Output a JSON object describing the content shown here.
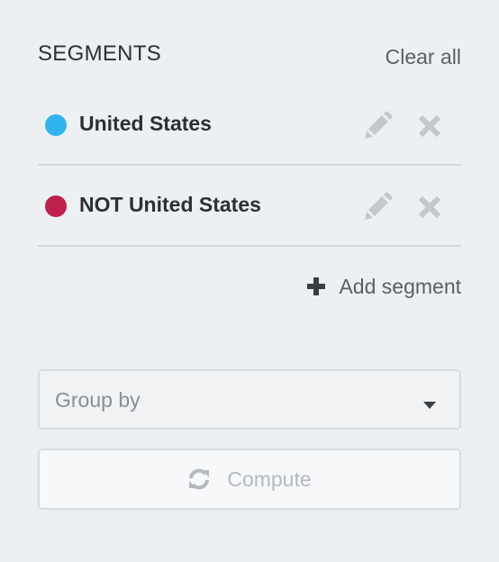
{
  "header": {
    "title": "SEGMENTS",
    "clear_all": "Clear all"
  },
  "segments": [
    {
      "label": "United States",
      "color": "#30b3ef"
    },
    {
      "label": "NOT United States",
      "color": "#c0204b"
    }
  ],
  "icons": {
    "edit": "pencil-icon",
    "remove": "close-icon",
    "add": "plus-icon",
    "dropdown": "caret-down-icon",
    "compute": "refresh-icon"
  },
  "add_segment": {
    "label": "Add segment"
  },
  "group_by": {
    "placeholder": "Group by"
  },
  "compute": {
    "label": "Compute"
  },
  "colors": {
    "background": "#edf0f3",
    "icon_gray": "#c4c7cb",
    "text_dark": "#2c2f33",
    "text_muted": "#5b6066"
  }
}
